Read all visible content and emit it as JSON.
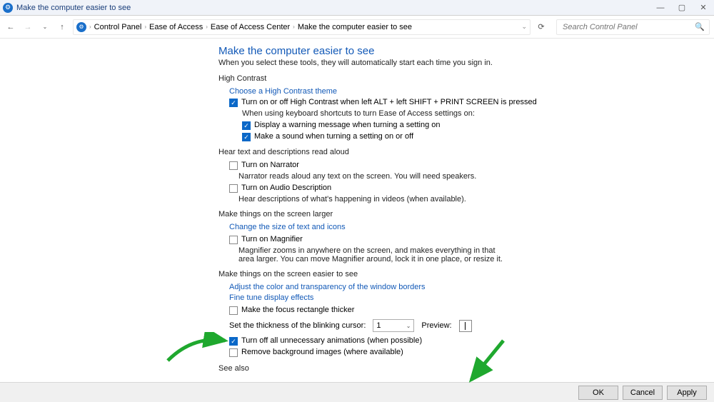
{
  "window": {
    "title": "Make the computer easier to see"
  },
  "breadcrumbs": {
    "a": "Control Panel",
    "b": "Ease of Access",
    "c": "Ease of Access Center",
    "d": "Make the computer easier to see"
  },
  "search": {
    "placeholder": "Search Control Panel"
  },
  "page": {
    "heading": "Make the computer easier to see",
    "subtitle": "When you select these tools, they will automatically start each time you sign in."
  },
  "hc": {
    "header": "High Contrast",
    "link": "Choose a High Contrast theme",
    "toggle": "Turn on or off High Contrast when left ALT + left SHIFT + PRINT SCREEN is pressed",
    "shortcut_note": "When using keyboard shortcuts to turn Ease of Access settings on:",
    "warn": "Display a warning message when turning a setting on",
    "sound": "Make a sound when turning a setting on or off"
  },
  "hear": {
    "header": "Hear text and descriptions read aloud",
    "narr": "Turn on Narrator",
    "narr_help": "Narrator reads aloud any text on the screen. You will need speakers.",
    "audio": "Turn on Audio Description",
    "audio_help": "Hear descriptions of what's happening in videos (when available)."
  },
  "larger": {
    "header": "Make things on the screen larger",
    "link": "Change the size of text and icons",
    "mag": "Turn on Magnifier",
    "mag_help": "Magnifier zooms in anywhere on the screen, and makes everything in that area larger. You can move Magnifier around, lock it in one place, or resize it."
  },
  "easier": {
    "header": "Make things on the screen easier to see",
    "link1": "Adjust the color and transparency of the window borders",
    "link2": "Fine tune display effects",
    "focus": "Make the focus rectangle thicker",
    "cursor_label": "Set the thickness of the blinking cursor:",
    "cursor_value": "1",
    "preview_label": "Preview:",
    "anim": "Turn off all unnecessary animations (when possible)",
    "bg": "Remove background images (where available)"
  },
  "seealso": {
    "header": "See also"
  },
  "footer": {
    "ok": "OK",
    "cancel": "Cancel",
    "apply": "Apply"
  }
}
